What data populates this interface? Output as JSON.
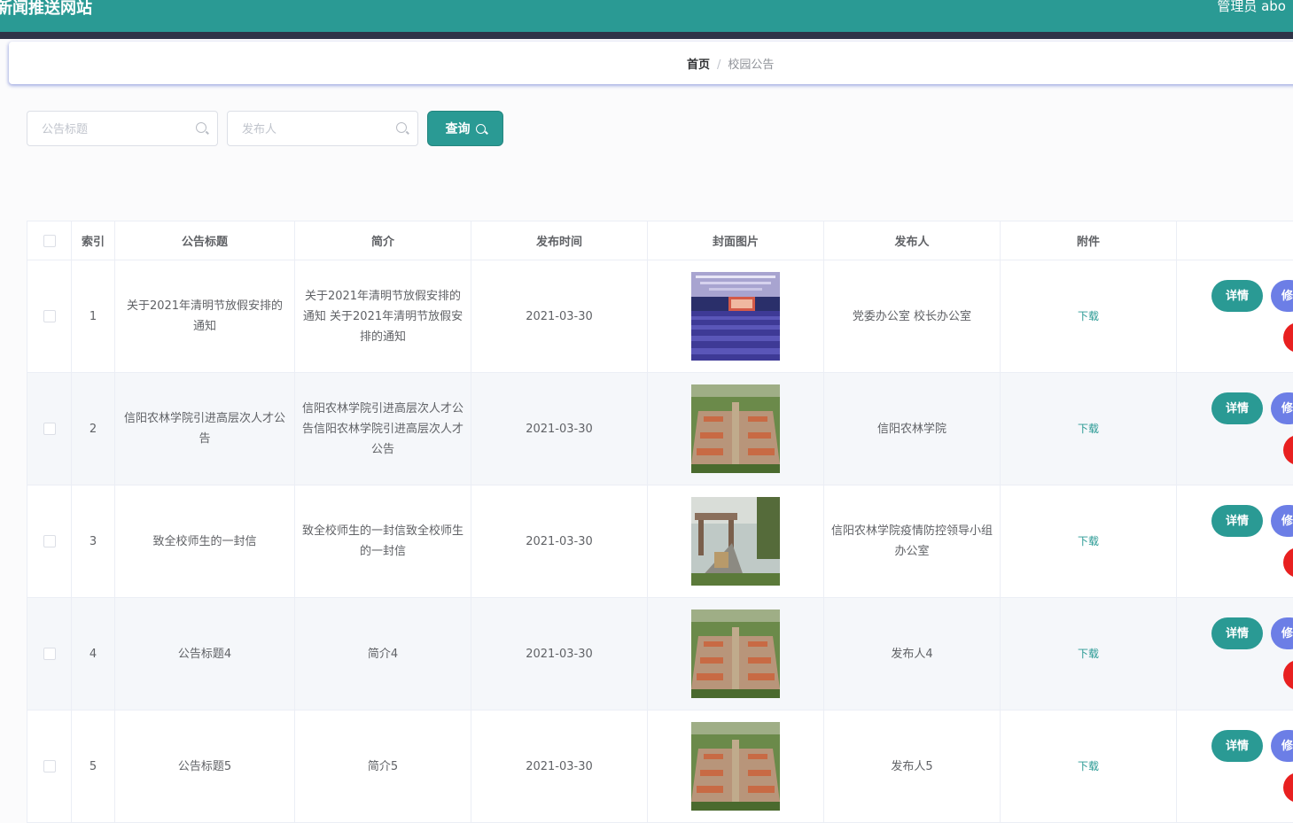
{
  "header": {
    "site_title": "新闻推送网站",
    "admin": "管理员 abo"
  },
  "breadcrumb": {
    "home": "首页",
    "separator": "/",
    "current": "校园公告"
  },
  "search": {
    "title_placeholder": "公告标题",
    "publisher_placeholder": "发布人",
    "query_label": "查询"
  },
  "table": {
    "headers": [
      "索引",
      "公告标题",
      "简介",
      "发布时间",
      "封面图片",
      "发布人",
      "附件"
    ],
    "rows": [
      {
        "index": "1",
        "title": "关于2021年清明节放假安排的通知",
        "summary": "关于2021年清明节放假安排的通知 关于2021年清明节放假安排的通知",
        "date": "2021-03-30",
        "cover": "auditorium",
        "publisher": "党委办公室 校长办公室",
        "attachment": "下载"
      },
      {
        "index": "2",
        "title": "信阳农林学院引进高层次人才公告",
        "summary": "信阳农林学院引进高层次人才公告信阳农林学院引进高层次人才公告",
        "date": "2021-03-30",
        "cover": "campus-aerial",
        "publisher": "信阳农林学院",
        "attachment": "下载"
      },
      {
        "index": "3",
        "title": "致全校师生的一封信",
        "summary": "致全校师生的一封信致全校师生的一封信",
        "date": "2021-03-30",
        "cover": "campus-gate",
        "publisher": "信阳农林学院疫情防控领导小组办公室",
        "attachment": "下载"
      },
      {
        "index": "4",
        "title": "公告标题4",
        "summary": "简介4",
        "date": "2021-03-30",
        "cover": "campus-aerial",
        "publisher": "发布人4",
        "attachment": "下载"
      },
      {
        "index": "5",
        "title": "公告标题5",
        "summary": "简介5",
        "date": "2021-03-30",
        "cover": "campus-aerial",
        "publisher": "发布人5",
        "attachment": "下载"
      }
    ],
    "actions": {
      "detail": "详情",
      "edit": "修"
    }
  },
  "colors": {
    "primary": "#2a9a94",
    "edit": "#6c7ee6",
    "delete": "#e82020",
    "nav_dark": "#2f3447"
  }
}
